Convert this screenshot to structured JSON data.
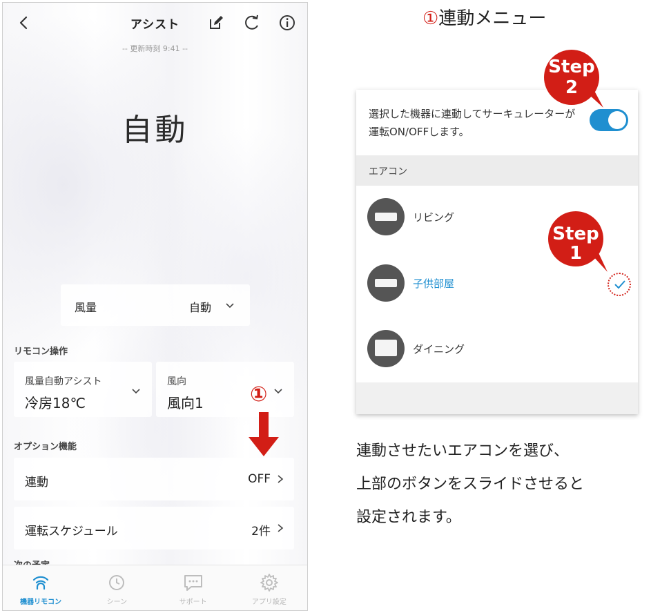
{
  "header": {
    "title": "アシスト",
    "update_time": "-- 更新時刻 9:41 --"
  },
  "mode": {
    "current": "自動"
  },
  "fan_card": {
    "label": "風量",
    "value": "自動"
  },
  "remote_section": {
    "label": "リモコン操作",
    "cards": [
      {
        "title": "風量自動アシスト",
        "value": "冷房18℃"
      },
      {
        "title": "風向",
        "value": "風向1"
      }
    ]
  },
  "option_section": {
    "label": "オプション機能",
    "items": [
      {
        "label": "連動",
        "value": "OFF"
      },
      {
        "label": "運転スケジュール",
        "value": "2件"
      }
    ],
    "next_schedule_label": "次の予定"
  },
  "annotation": {
    "circle_number": "①"
  },
  "tabs": [
    {
      "label": "機器リモコン",
      "icon": "remote-wifi-icon",
      "active": true
    },
    {
      "label": "シーン",
      "icon": "clock-icon",
      "active": false
    },
    {
      "label": "サポート",
      "icon": "chat-icon",
      "active": false
    },
    {
      "label": "アプリ設定",
      "icon": "gear-icon",
      "active": false
    }
  ],
  "menu_title": {
    "circle": "①",
    "text": "連動メニュー"
  },
  "panel": {
    "description": "選択した機器に連動してサーキュレーターが運転ON/OFFします。",
    "toggle_on": true,
    "group_label": "エアコン",
    "devices": [
      {
        "name": "リビング",
        "selected": false
      },
      {
        "name": "子供部屋",
        "selected": true
      },
      {
        "name": "ダイニング",
        "selected": false
      }
    ]
  },
  "steps": [
    {
      "word": "Step",
      "number": "2"
    },
    {
      "word": "Step",
      "number": "1"
    }
  ],
  "instruction": {
    "lines": [
      "連動させたいエアコンを選び、",
      "上部のボタンをスライドさせると",
      "設定されます。"
    ]
  },
  "colors": {
    "accent": "#1f8fd0",
    "annotation_red": "#d21e16"
  }
}
